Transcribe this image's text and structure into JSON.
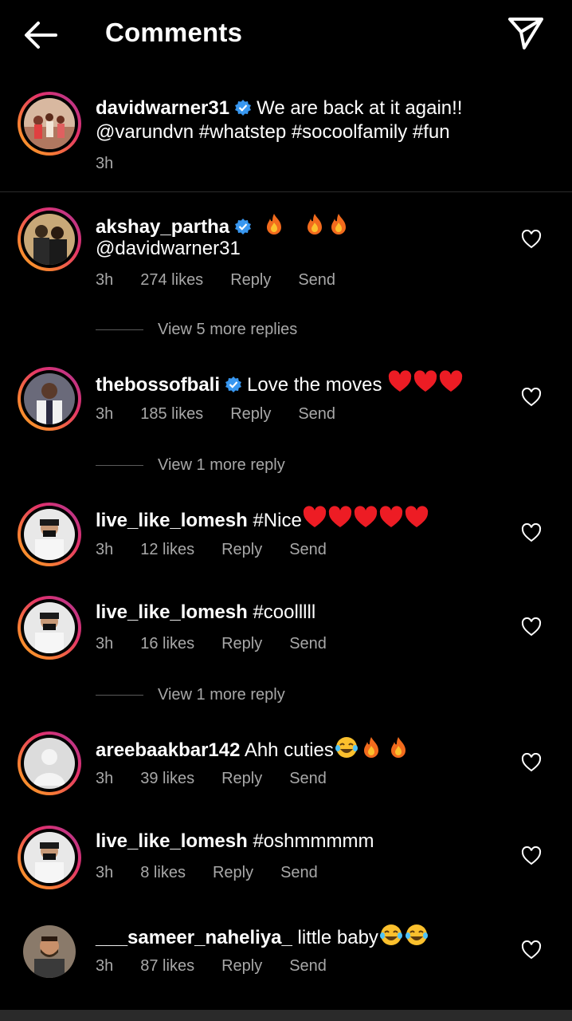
{
  "header": {
    "title": "Comments",
    "back_icon": "arrow-left-icon",
    "share_icon": "paper-plane-icon"
  },
  "caption": {
    "username": "davidwarner31",
    "verified": true,
    "text_line1": "We are back at it again!!",
    "text_line2": "@varundvn #whatstep #socoolfamily #fun",
    "time": "3h"
  },
  "comments": [
    {
      "username": "akshay_partha",
      "verified": true,
      "text": " ",
      "text_line2": "@davidwarner31",
      "emojis": "fire fire fire",
      "time": "3h",
      "likes": "274 likes",
      "reply": "Reply",
      "send": "Send",
      "view_replies": "View 5 more replies"
    },
    {
      "username": "thebossofbali",
      "verified": true,
      "text": "Love the moves ",
      "emojis": "heart heart heart",
      "time": "3h",
      "likes": "185 likes",
      "reply": "Reply",
      "send": "Send",
      "view_replies": "View 1 more reply"
    },
    {
      "username": "live_like_lomesh",
      "verified": false,
      "text": "#Nice",
      "emojis": "heart heart heart heart heart",
      "time": "3h",
      "likes": "12 likes",
      "reply": "Reply",
      "send": "Send"
    },
    {
      "username": "live_like_lomesh",
      "verified": false,
      "text": "#coolllll",
      "time": "3h",
      "likes": "16 likes",
      "reply": "Reply",
      "send": "Send",
      "view_replies": "View 1 more reply"
    },
    {
      "username": "areebaakbar142",
      "verified": false,
      "text": "Ahh cuties",
      "emojis": "joy fire fire",
      "time": "3h",
      "likes": "39 likes",
      "reply": "Reply",
      "send": "Send"
    },
    {
      "username": "live_like_lomesh",
      "verified": false,
      "text": "#oshmmmmm",
      "time": "3h",
      "likes": "8 likes",
      "reply": "Reply",
      "send": "Send"
    },
    {
      "username": "___sameer_naheliya_",
      "verified": false,
      "text": "little baby",
      "emojis": "joy joy",
      "time": "3h",
      "likes": "87 likes",
      "reply": "Reply",
      "send": "Send"
    }
  ],
  "colors": {
    "background": "#000000",
    "secondary_text": "#a8a8a8",
    "verified_blue": "#3897f0",
    "heart_red": "#ed1c24"
  }
}
